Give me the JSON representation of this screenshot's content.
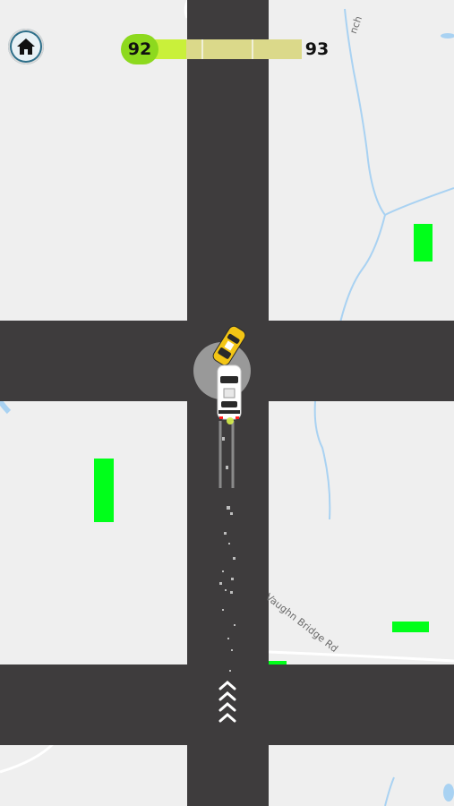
{
  "hud": {
    "current_level": "92",
    "next_level": "93",
    "progress": 0.3,
    "home_icon": "home-icon"
  },
  "map": {
    "street_label_1": "Vaughn Bridge Rd",
    "street_label_2": "nch"
  },
  "colors": {
    "road": "#3e3c3d",
    "ground": "#efefef",
    "water": "#a9d2f2",
    "checkpoint": "#00ff1a",
    "progress_fill": "#c9f03a",
    "progress_bg": "#dbd98a",
    "level_badge": "#8dd91e"
  }
}
